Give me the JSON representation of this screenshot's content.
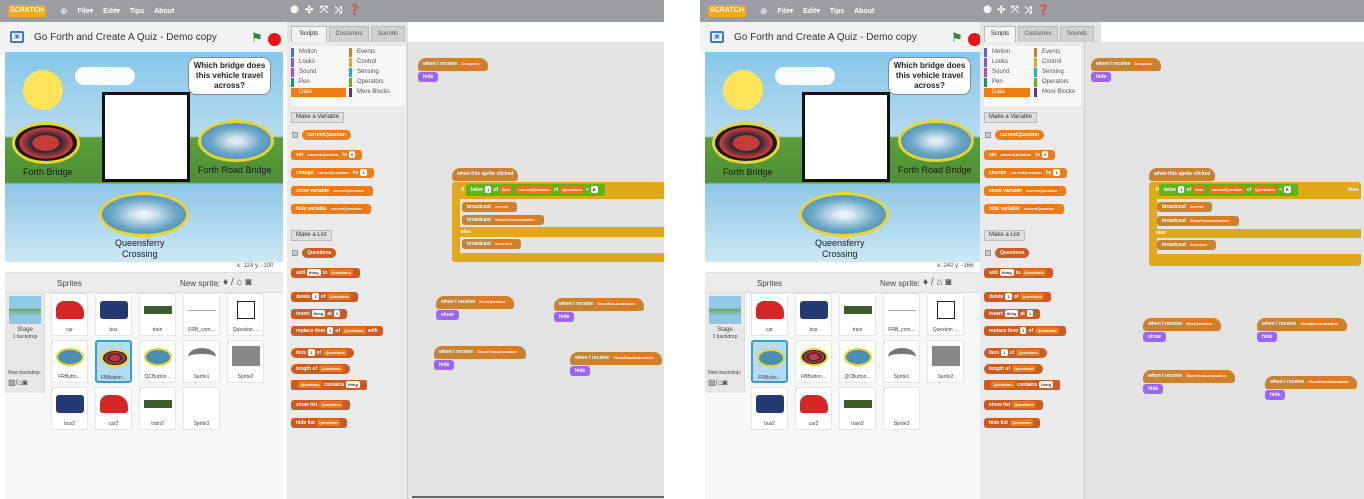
{
  "menubar": {
    "logo": "SCRATCH",
    "file": "File▾",
    "edit": "Edit▾",
    "tips": "Tips",
    "about": "About"
  },
  "project": {
    "title": "Go Forth and Create A Quiz - Demo copy"
  },
  "stage": {
    "speech": "Which bridge does this vehicle travel across?",
    "labels": {
      "forth": "Forth Bridge",
      "road": "Forth Road Bridge",
      "q1": "Queensferry",
      "q2": "Crossing"
    },
    "coords_1": "x: 124   y: -100",
    "coords_2": "x: 240   y: -166"
  },
  "sprites": {
    "header": "Sprites",
    "new_sprite": "New sprite:",
    "stage_label": "Stage",
    "stage_sub": "1 backdrop",
    "new_backdrop": "New backdrop:",
    "tiles": [
      {
        "label": "car"
      },
      {
        "label": "bus"
      },
      {
        "label": "train"
      },
      {
        "label": "FRB_com..."
      },
      {
        "label": "Question ..."
      },
      {
        "label": "FRButto..."
      },
      {
        "label": "FBButton..."
      },
      {
        "label": "QCButton..."
      },
      {
        "label": "Sprite1"
      },
      {
        "label": "Sprite2"
      },
      {
        "label": "bus2"
      },
      {
        "label": "car2"
      },
      {
        "label": "train2"
      },
      {
        "label": "Sprite3"
      }
    ]
  },
  "tabs": {
    "scripts": "Scripts",
    "costumes": "Costumes",
    "sounds": "Sounds"
  },
  "categories": {
    "motion": "Motion",
    "looks": "Looks",
    "sound": "Sound",
    "pen": "Pen",
    "data": "Data",
    "events": "Events",
    "control": "Control",
    "sensing": "Sensing",
    "operators": "Operators",
    "more": "More Blocks"
  },
  "palette": {
    "make_var": "Make a Variable",
    "var_name": "currentQuestion",
    "set": "set",
    "to": "to",
    "change": "change",
    "by": "by",
    "show_var": "show variable",
    "hide_var": "hide variable",
    "make_list": "Make a List",
    "list_name": "Questions",
    "add": "add",
    "thing": "thing",
    "to_list": "to",
    "delete": "delete",
    "of": "of",
    "insert": "insert",
    "at": "at",
    "replace": "replace item",
    "with": "with",
    "item": "item",
    "length": "length of",
    "contains": "contains",
    "show_list": "show list",
    "hide_list": "hide list",
    "num1": "1",
    "num0": "0"
  },
  "scripts": {
    "receive": "when I receive",
    "complete": "Complete",
    "hide": "hide",
    "show": "show",
    "sprite_clicked": "when this sprite clicked",
    "if": "if",
    "then": "then",
    "else": "else",
    "letter": "letter",
    "of": "of",
    "item": "item",
    "eq": "=",
    "letter_val": "1",
    "eq_val": "B",
    "broadcast": "broadcast",
    "correct": "correct",
    "show_train": "ShowTrainAnimation",
    "incorrect": "incorrect",
    "next_q": "NextQuestion",
    "show_bus": "ShowBusAnimation",
    "show_train2": "ShowTrainAnimation",
    "show_road": "ShowRoadAnimation"
  }
}
